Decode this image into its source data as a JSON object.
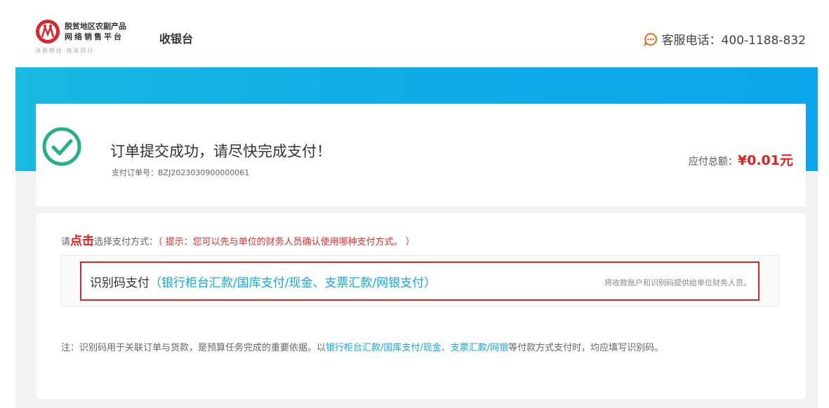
{
  "header": {
    "logo_line1": "脱贫地区农副产品",
    "logo_line2": "网络销售平台",
    "logo_line3": "消费帮扶·政采同行",
    "page_title": "收银台",
    "service_label": "客服电话：400-1188-832"
  },
  "order": {
    "title": "订单提交成功，请尽快完成支付！",
    "order_no": "支付订单号：BZJ2023030900000061",
    "amount_label": "应付总额：",
    "amount_value": "¥0.01元"
  },
  "payment": {
    "hint_prefix": "请",
    "hint_click": "点击",
    "hint_suffix": "选择支付方式：",
    "hint_tip": "（ 提示：您可以先与单位的财务人员确认使用哪种支付方式。 ）",
    "option_name": "识别码支付",
    "option_methods": "（银行柜台汇款/国库支付/现金、支票汇款/网银支付）",
    "option_note": "将收款账户和识别码提供给单位财务人员。",
    "footnote_prefix": "注：识别码用于关联订单与货款，是预算任务完成的重要依据。以",
    "footnote_link": "银行柜台汇款/国库支付/现金、支票汇款/网银",
    "footnote_suffix": "等付款方式支付时，均应填写识别码。"
  },
  "colors": {
    "accent_blue": "#10aee6",
    "alert_red": "#e61e1e",
    "success_green": "#26b08a",
    "service_orange": "#f26b1d"
  }
}
